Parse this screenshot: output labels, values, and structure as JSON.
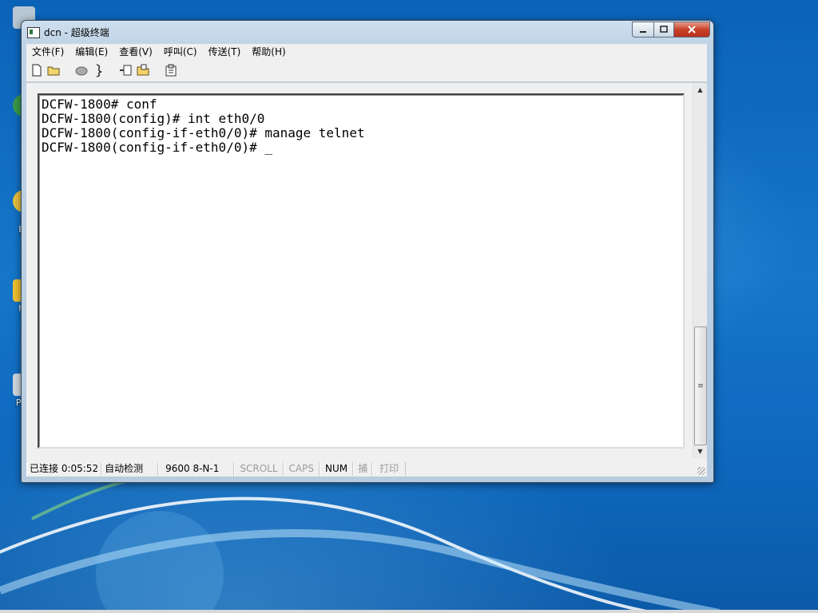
{
  "window": {
    "title": "dcn - 超级终端"
  },
  "menu": [
    "文件(F)",
    "编辑(E)",
    "查看(V)",
    "呼叫(C)",
    "传送(T)",
    "帮助(H)"
  ],
  "toolbar": {
    "icons": [
      "new-file-icon",
      "open-folder-icon",
      "dial-icon",
      "disconnect-icon",
      "send-icon",
      "receive-icon",
      "properties-icon"
    ]
  },
  "terminal": {
    "lines": [
      "DCFW-1800# conf",
      "DCFW-1800(config)# int eth0/0",
      "DCFW-1800(config-if-eth0/0)# manage telnet",
      "DCFW-1800(config-if-eth0/0)# _"
    ]
  },
  "status": {
    "connection": "已连接 0:05:52",
    "detect": "自动检测",
    "port": "9600 8-N-1",
    "scroll": "SCROLL",
    "caps": "CAPS",
    "num": "NUM",
    "capture": "捕",
    "print": "打印"
  },
  "desktop": {
    "labels": [
      "Ir",
      "Ex",
      "hy",
      "PuT"
    ]
  },
  "colors": {
    "desktop": "#1576c9",
    "terminal_bg": "#ffffff",
    "close_button": "#c8412a"
  }
}
